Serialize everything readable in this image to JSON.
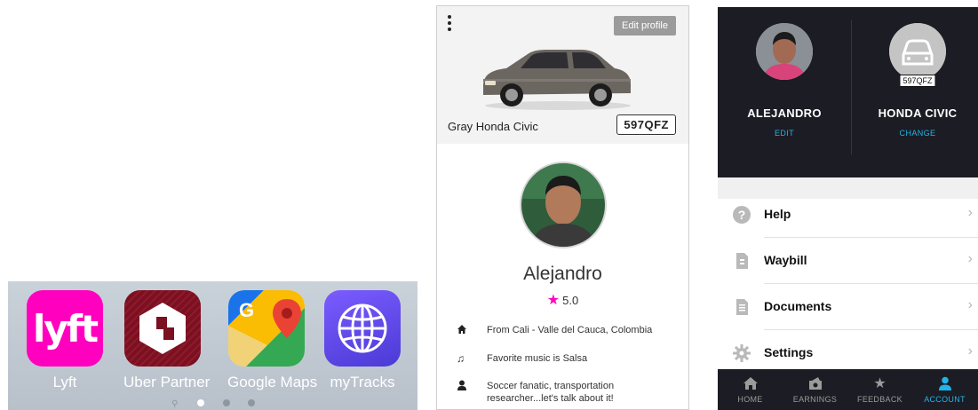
{
  "dock": {
    "apps": [
      {
        "label": "Lyft",
        "logo_text": "lyft",
        "color": "#ff00bf"
      },
      {
        "label": "Uber Partner",
        "color": "#7a1020"
      },
      {
        "label": "Google Maps"
      },
      {
        "label": "myTracks",
        "color": "#5b45e6"
      }
    ],
    "page_count": 4,
    "active_page": 1
  },
  "profile": {
    "edit_button": "Edit profile",
    "car_name": "Gray Honda Civic",
    "plate": "597QFZ",
    "driver_name": "Alejandro",
    "rating": "5.0",
    "accent_color": "#ff00bf",
    "info": [
      {
        "icon": "home-icon",
        "text": "From Cali - Valle del Cauca, Colombia"
      },
      {
        "icon": "music-note-icon",
        "text": "Favorite music is Salsa"
      },
      {
        "icon": "person-icon",
        "text": "Soccer fanatic, transportation researcher...let's talk about it!"
      }
    ]
  },
  "account": {
    "driver_name": "ALEJANDRO",
    "driver_action": "EDIT",
    "vehicle_name": "HONDA CIVIC",
    "vehicle_action": "CHANGE",
    "vehicle_plate": "597QFZ",
    "accent_color": "#1fb5e8",
    "menu": [
      {
        "label": "Help",
        "icon": "help-icon"
      },
      {
        "label": "Waybill",
        "icon": "waybill-icon"
      },
      {
        "label": "Documents",
        "icon": "documents-icon"
      },
      {
        "label": "Settings",
        "icon": "settings-icon"
      }
    ],
    "tabs": [
      {
        "label": "HOME",
        "icon": "home-icon"
      },
      {
        "label": "EARNINGS",
        "icon": "earnings-icon"
      },
      {
        "label": "FEEDBACK",
        "icon": "star-icon"
      },
      {
        "label": "ACCOUNT",
        "icon": "person-icon",
        "active": true
      }
    ]
  }
}
